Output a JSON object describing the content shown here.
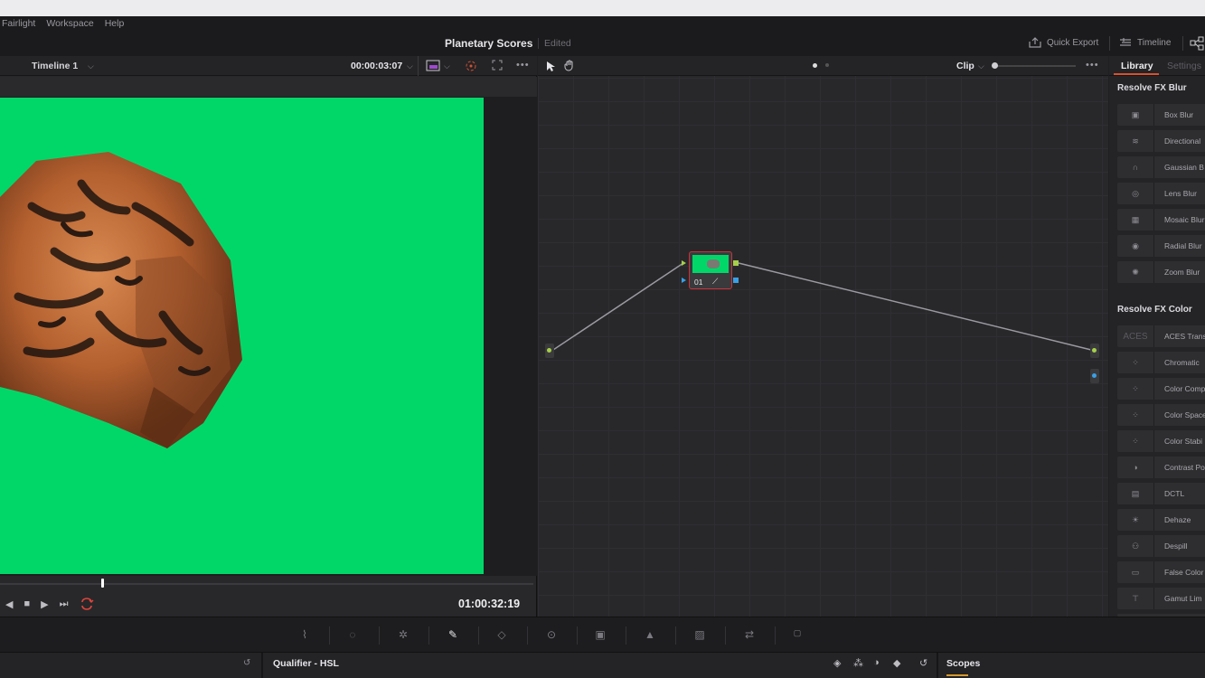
{
  "menu": [
    "Fairlight",
    "Workspace",
    "Help"
  ],
  "title": {
    "project": "Planetary Scores",
    "status": "Edited"
  },
  "topright": {
    "quick_export": "Quick Export",
    "timeline": "Timeline"
  },
  "viewer": {
    "timeline_name": "Timeline 1",
    "source_timecode": "00:00:03:07",
    "playhead_timecode": "01:00:32:19",
    "more": "•••"
  },
  "node_editor": {
    "mode": "Clip",
    "more": "•••",
    "node_label": "01"
  },
  "library": {
    "tabs": [
      "Library",
      "Settings"
    ],
    "sections": [
      {
        "title": "Resolve FX Blur",
        "items": [
          "Box Blur",
          "Directional",
          "Gaussian B",
          "Lens Blur",
          "Mosaic Blur",
          "Radial Blur",
          "Zoom Blur"
        ]
      },
      {
        "title": "Resolve FX Color",
        "items": [
          "ACES Trans",
          "Chromatic",
          "Color Comp",
          "Color Space",
          "Color Stabi",
          "Contrast Po",
          "DCTL",
          "Dehaze",
          "Despill",
          "False Color",
          "Gamut Lim"
        ]
      }
    ],
    "aces_icon_text": "ACES"
  },
  "bottom": {
    "qualifier": "Qualifier - HSL",
    "scopes": "Scopes"
  },
  "colors": {
    "green_screen": "#00d768",
    "node_border": "#c9343a",
    "accent_orange": "#d6522e"
  }
}
